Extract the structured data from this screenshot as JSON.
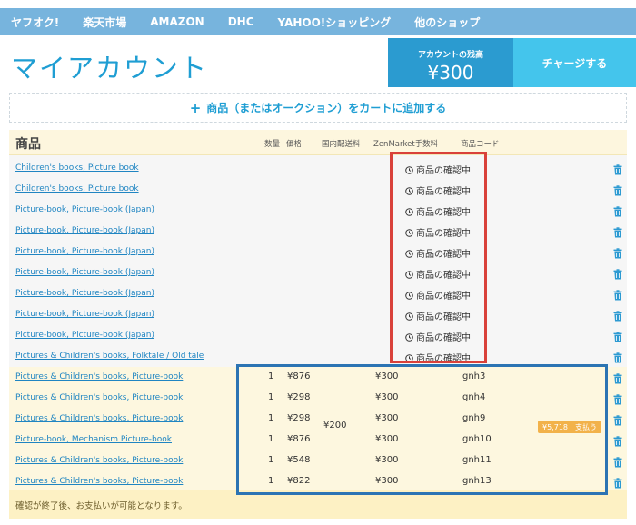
{
  "nav": [
    "ヤフオク!",
    "楽天市場",
    "AMAZON",
    "DHC",
    "YAHOO!ショッピング",
    "他のショップ"
  ],
  "page_title": "マイアカウント",
  "balance": {
    "label": "アカウントの残高",
    "amount": "¥300"
  },
  "charge_button": "チャージする",
  "add_to_cart": {
    "icon": "plus-icon",
    "label": "商品（またはオークション）をカートに追加する"
  },
  "table": {
    "title": "商品",
    "columns": {
      "qty": "数量",
      "price": "価格",
      "shipping": "国内配送料",
      "fee": "ZenMarket手数料",
      "code": "商品コード"
    },
    "pending": [
      {
        "name": "Children's books, Picture book",
        "status": "商品の確認中"
      },
      {
        "name": "Children's books, Picture book",
        "status": "商品の確認中"
      },
      {
        "name": "Picture-book, Picture-book (Japan)",
        "status": "商品の確認中"
      },
      {
        "name": "Picture-book, Picture-book (Japan)",
        "status": "商品の確認中"
      },
      {
        "name": "Picture-book, Picture-book (Japan)",
        "status": "商品の確認中"
      },
      {
        "name": "Picture-book, Picture-book (Japan)",
        "status": "商品の確認中"
      },
      {
        "name": "Picture-book, Picture-book (Japan)",
        "status": "商品の確認中"
      },
      {
        "name": "Picture-book, Picture-book (Japan)",
        "status": "商品の確認中"
      },
      {
        "name": "Picture-book, Picture-book (Japan)",
        "status": "商品の確認中"
      },
      {
        "name": "Pictures & Children's books, Folktale / Old tale",
        "status": "商品の確認中"
      }
    ],
    "confirmed": [
      {
        "name": "Pictures & Children's books, Picture-book",
        "qty": "1",
        "price": "¥876",
        "fee": "¥300",
        "code": "gnh3"
      },
      {
        "name": "Pictures & Children's books, Picture-book",
        "qty": "1",
        "price": "¥298",
        "fee": "¥300",
        "code": "gnh4"
      },
      {
        "name": "Pictures & Children's books, Picture-book",
        "qty": "1",
        "price": "¥298",
        "fee": "¥300",
        "code": "gnh9"
      },
      {
        "name": "Picture-book, Mechanism Picture-book",
        "qty": "1",
        "price": "¥876",
        "fee": "¥300",
        "code": "gnh10"
      },
      {
        "name": "Pictures & Children's books, Picture-book",
        "qty": "1",
        "price": "¥548",
        "fee": "¥300",
        "code": "gnh11"
      },
      {
        "name": "Pictures & Children's books, Picture-book",
        "qty": "1",
        "price": "¥822",
        "fee": "¥300",
        "code": "gnh13"
      }
    ],
    "shipping_total": "¥200",
    "pay": {
      "amount": "¥5,718",
      "label": "支払う"
    },
    "footer_note": "確認が終了後、お支払いが可能となります。"
  },
  "colors": {
    "nav": "#77b4dd",
    "accent": "#1f9ed3",
    "balance": "#2b9bd0",
    "charge": "#44c5ec",
    "pay": "#f2b24a",
    "highlight_red": "#d9413a",
    "highlight_blue": "#2c74b3"
  }
}
